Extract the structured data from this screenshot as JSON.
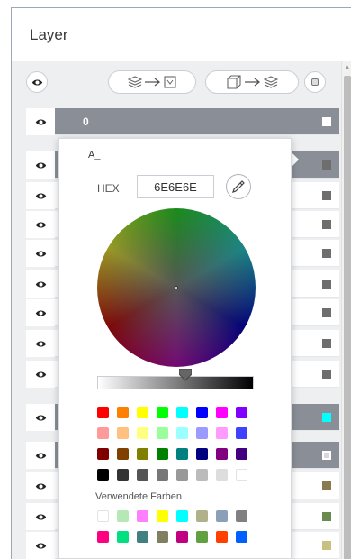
{
  "panel": {
    "title": "Layer"
  },
  "colors": {
    "eye": "#222222",
    "group_row": "#8a8f97",
    "panel_bg": "#eeeff1",
    "cyan_square": "#00ffff"
  },
  "icons": {
    "visibility": "eye-icon",
    "layers_to_box": "layers-to-box-icon",
    "box_to_layers": "box-to-layers-icon",
    "menu": "menu-icon",
    "pipette": "pipette-icon",
    "scroll_up": "scroll-up-icon"
  },
  "layers": {
    "group_0_label": "0"
  },
  "picker": {
    "title": "A_",
    "hex_label": "HEX",
    "hex_value": "6E6E6E",
    "current_color": "#6e6e6e",
    "brightness": 0.58,
    "palette": [
      [
        "#ff0000",
        "#ff8000",
        "#ffff00",
        "#00ff00",
        "#00ffff",
        "#0000ff",
        "#ff00ff",
        "#8000ff"
      ],
      [
        "#ff9a9a",
        "#ffc080",
        "#ffff80",
        "#9aff9a",
        "#9affff",
        "#9a9aff",
        "#ff9aff",
        "#4040ff"
      ],
      [
        "#800000",
        "#804000",
        "#808000",
        "#008000",
        "#008080",
        "#000080",
        "#800080",
        "#400080"
      ],
      [
        "#000000",
        "#333333",
        "#555555",
        "#777777",
        "#999999",
        "#bbbbbb",
        "#dddddd",
        "#ffffff"
      ]
    ],
    "used_label": "Verwendete Farben",
    "used_colors": [
      [
        "#ffffff",
        "#b6e8b6",
        "#ff80ff",
        "#ffff00",
        "#00ffff",
        "#b0b08a",
        "#8aa0b8",
        "#808080"
      ],
      [
        "#ff0080",
        "#00e080",
        "#408080",
        "#808060",
        "#c00080",
        "#60a040",
        "#ff4000",
        "#0060ff"
      ]
    ]
  }
}
